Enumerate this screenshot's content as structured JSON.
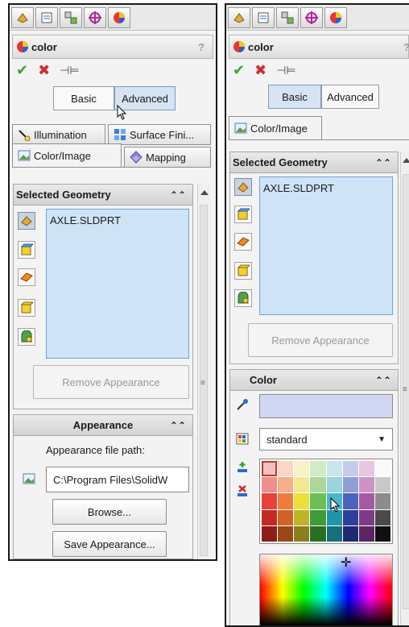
{
  "left": {
    "title": "color",
    "help": "?",
    "toggle": {
      "basic": "Basic",
      "advanced": "Advanced"
    },
    "tabs": {
      "illumination": "Illumination",
      "surface": "Surface Fini...",
      "color_image": "Color/Image",
      "mapping": "Mapping"
    },
    "selected_geometry": {
      "title": "Selected Geometry",
      "item": "AXLE.SLDPRT",
      "remove": "Remove Appearance"
    },
    "appearance": {
      "title": "Appearance",
      "path_label": "Appearance file path:",
      "path_value": "C:\\Program Files\\SolidW",
      "browse": "Browse...",
      "save": "Save Appearance..."
    }
  },
  "right": {
    "title": "color",
    "help": "?",
    "toggle": {
      "basic": "Basic",
      "advanced": "Advanced"
    },
    "tabs": {
      "color_image": "Color/Image"
    },
    "selected_geometry": {
      "title": "Selected Geometry",
      "item": "AXLE.SLDPRT",
      "remove": "Remove Appearance"
    },
    "color": {
      "title": "Color",
      "color_value": "",
      "palette": "standard",
      "selected_swatch": 0,
      "swatch_colors": [
        "#f4c1c1",
        "#fbd5c5",
        "#f7f2c8",
        "#d3eac6",
        "#c9e6ea",
        "#c5cce9",
        "#e6c7df",
        "#f9f9f9",
        "#f08d8d",
        "#f5ad8a",
        "#f3e892",
        "#a9d89a",
        "#98d3de",
        "#8f9ed6",
        "#cd93c3",
        "#c9c9c9",
        "#e8413a",
        "#ef7c3a",
        "#ece03c",
        "#6bbf55",
        "#4ab8cc",
        "#4a63bf",
        "#a758a2",
        "#8c8c8c",
        "#c32a24",
        "#cf6224",
        "#bfb32a",
        "#3f9a38",
        "#1e96aa",
        "#2c3f9b",
        "#7e3a85",
        "#4a4a4a",
        "#8f1c17",
        "#9a4818",
        "#8a7f1c",
        "#2a6f24",
        "#156f7e",
        "#1e2a70",
        "#5a2560",
        "#111111"
      ]
    }
  },
  "colors": {
    "panel_bg": "#f3f3f3",
    "list_bg": "#cfe3f6",
    "accent_blue": "#6aa3d8"
  }
}
